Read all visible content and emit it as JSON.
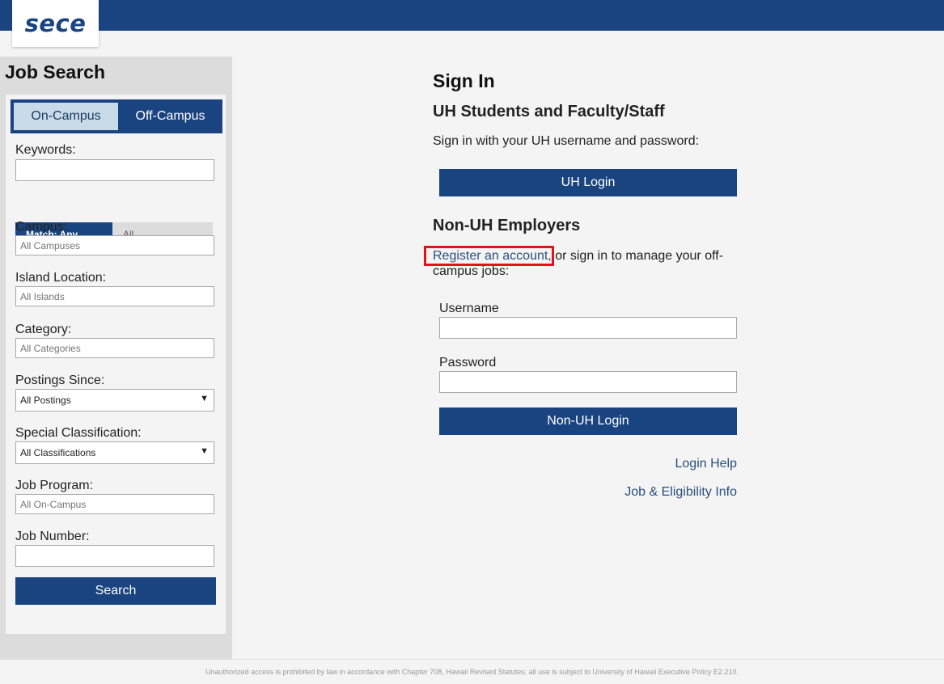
{
  "header": {
    "logo_text": "sece"
  },
  "sidebar": {
    "title": "Job Search",
    "tabs": [
      {
        "label": "On-Campus"
      },
      {
        "label": "Off-Campus"
      }
    ],
    "keywords": {
      "label": "Keywords:",
      "value": "",
      "match_any": "Match: Any",
      "match_all": "All"
    },
    "campus": {
      "label": "Campus:",
      "placeholder": "All Campuses"
    },
    "island": {
      "label": "Island Location:",
      "placeholder": "All Islands"
    },
    "category": {
      "label": "Category:",
      "placeholder": "All Categories"
    },
    "postings_since": {
      "label": "Postings Since:",
      "selected": "All Postings"
    },
    "special": {
      "label": "Special Classification:",
      "selected": "All Classifications"
    },
    "job_program": {
      "label": "Job Program:",
      "placeholder": "All On-Campus"
    },
    "job_number": {
      "label": "Job Number:",
      "value": ""
    },
    "search_button": "Search"
  },
  "main": {
    "title": "Sign In",
    "uh_heading": "UH Students and Faculty/Staff",
    "uh_text": "Sign in with your UH username and password:",
    "uh_login_button": "UH Login",
    "non_uh_heading": "Non-UH Employers",
    "register_link": "Register an account,",
    "register_rest_1": " or sign in to manage your off-",
    "register_rest_2": "campus jobs:",
    "username_label": "Username",
    "password_label": "Password",
    "non_uh_login_button": "Non-UH Login",
    "login_help": "Login Help",
    "eligibility_info": "Job & Eligibility Info"
  },
  "footer": {
    "text": "Unauthorized access is prohibited by law in accordance with Chapter 708, Hawaii Revised Statutes; all use is subject to University of Hawaii Executive Policy E2.210."
  }
}
